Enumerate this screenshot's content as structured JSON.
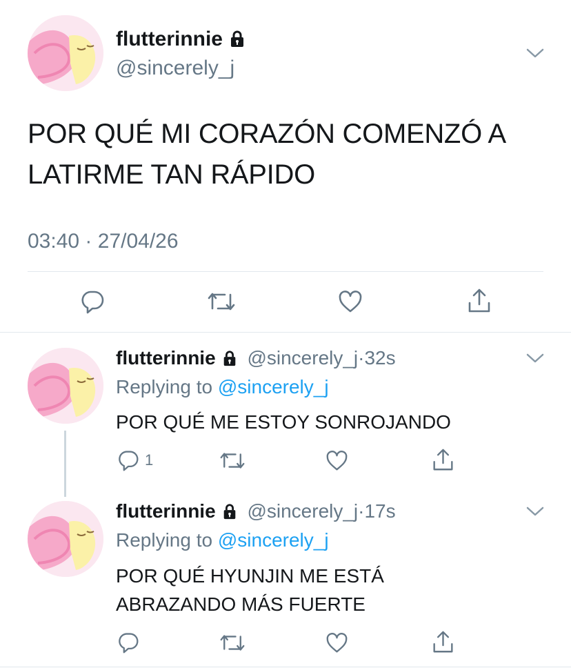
{
  "main_tweet": {
    "name": "flutterinnie",
    "handle": "@sincerely_j",
    "text_line1": "POR QUÉ MI CORAZÓN COMENZÓ A",
    "text_line2": "LATIRME TAN RÁPIDO",
    "time": "03:40",
    "separator": "·",
    "date": "27/04/26"
  },
  "replies": [
    {
      "name": "flutterinnie",
      "handle": "@sincerely_j",
      "time_ago": "32s",
      "replying_label": "Replying to",
      "replying_handle": "@sincerely_j",
      "text_line1": "POR QUÉ ME ESTOY SONROJANDO",
      "reply_count": "1"
    },
    {
      "name": "flutterinnie",
      "handle": "@sincerely_j",
      "time_ago": "17s",
      "replying_label": "Replying to",
      "replying_handle": "@sincerely_j",
      "text_line1": "POR QUÉ HYUNJIN ME ESTÁ",
      "text_line2": "ABRAZANDO MÁS FUERTE"
    }
  ],
  "colors": {
    "text": "#14171a",
    "secondary": "#657786",
    "link": "#1da1f2",
    "divider": "#e1e8ed"
  },
  "icons": [
    "lock-icon",
    "chevron-down-icon",
    "reply-icon",
    "retweet-icon",
    "like-icon",
    "share-icon"
  ]
}
